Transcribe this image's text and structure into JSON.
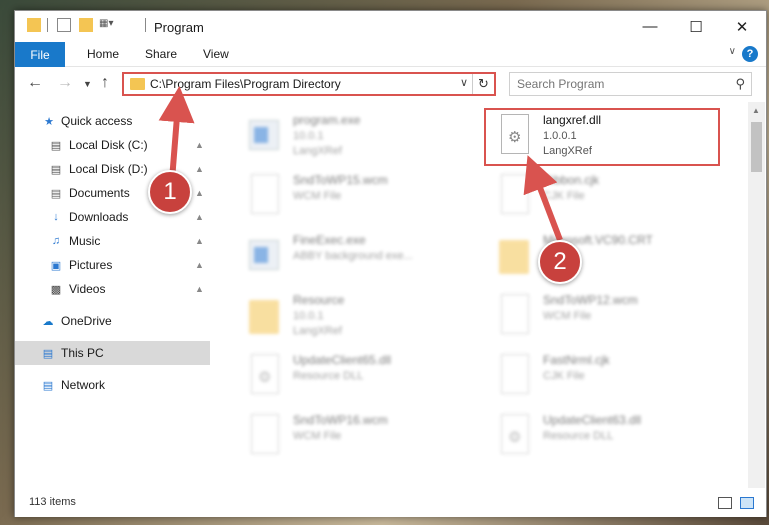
{
  "window": {
    "title": "Program",
    "minimize_icon": "minimize-icon",
    "maximize_icon": "maximize-icon",
    "close_icon": "close-icon"
  },
  "ribbon": {
    "tabs": [
      "File",
      "Home",
      "Share",
      "View"
    ],
    "accent": "#1979ca"
  },
  "nav": {
    "address": "C:\\Program Files\\Program Directory",
    "search_placeholder": "Search Program"
  },
  "sidebar": {
    "items": [
      {
        "label": "Quick access",
        "icon": "star-icon"
      },
      {
        "label": "Local Disk (C:)",
        "icon": "drive-icon"
      },
      {
        "label": "Local Disk (D:)",
        "icon": "drive-icon"
      },
      {
        "label": "Documents",
        "icon": "documents-icon"
      },
      {
        "label": "Downloads",
        "icon": "download-icon"
      },
      {
        "label": "Music",
        "icon": "music-icon"
      },
      {
        "label": "Pictures",
        "icon": "pictures-icon"
      },
      {
        "label": "Videos",
        "icon": "videos-icon"
      },
      {
        "label": "OneDrive",
        "icon": "cloud-icon"
      },
      {
        "label": "This PC",
        "icon": "computer-icon"
      },
      {
        "label": "Network",
        "icon": "network-icon"
      }
    ]
  },
  "files": [
    {
      "name": "program.exe",
      "line2": "10.0.1",
      "line3": "LangXRef"
    },
    {
      "name": "langxref.dll",
      "line2": "1.0.0.1",
      "line3": "LangXRef"
    },
    {
      "name": "SndToWP15.wcm",
      "line2": "WCM File",
      "line3": ""
    },
    {
      "name": "Ribbon.cjk",
      "line2": "CJK File",
      "line3": ""
    },
    {
      "name": "FineExec.exe",
      "line2": "ABBY background exe...",
      "line3": ""
    },
    {
      "name": "Microsoft.VC90.CRT",
      "line2": "",
      "line3": ""
    },
    {
      "name": "Resource",
      "line2": "10.0.1",
      "line3": "LangXRef"
    },
    {
      "name": "SndToWP12.wcm",
      "line2": "WCM File",
      "line3": ""
    },
    {
      "name": "UpdateClient65.dll",
      "line2": "Resource DLL",
      "line3": ""
    },
    {
      "name": "FastNrml.cjk",
      "line2": "CJK File",
      "line3": ""
    },
    {
      "name": "SndToWP16.wcm",
      "line2": "WCM File",
      "line3": ""
    },
    {
      "name": "UpdateClient63.dll",
      "line2": "Resource DLL",
      "line3": ""
    }
  ],
  "status": {
    "count": "113 items"
  },
  "annotations": {
    "step1": "1",
    "step2": "2",
    "color": "#d9534f"
  }
}
